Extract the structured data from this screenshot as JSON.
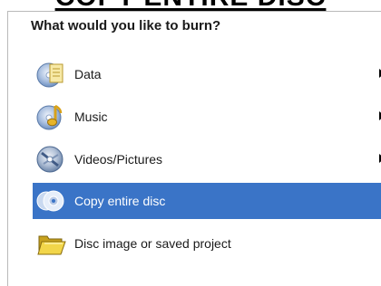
{
  "banner": {
    "text": "COPY ENTIRE DISC"
  },
  "menu": {
    "heading": "What would you like to burn?",
    "items": [
      {
        "label": "Data",
        "icon": "data-disc-document-icon",
        "has_submenu": true,
        "selected": false
      },
      {
        "label": "Music",
        "icon": "music-disc-note-icon",
        "has_submenu": true,
        "selected": false
      },
      {
        "label": "Videos/Pictures",
        "icon": "videos-pictures-disc-icon",
        "has_submenu": true,
        "selected": false
      },
      {
        "label": "Copy entire disc",
        "icon": "copy-disc-icon",
        "has_submenu": false,
        "selected": true
      },
      {
        "label": "Disc image or saved project",
        "icon": "open-folder-icon",
        "has_submenu": false,
        "selected": false
      }
    ]
  },
  "colors": {
    "selection": "#3a74c7",
    "panel_border": "#b9b9b9",
    "text": "#1a1a1a",
    "selected_text": "#ffffff"
  }
}
